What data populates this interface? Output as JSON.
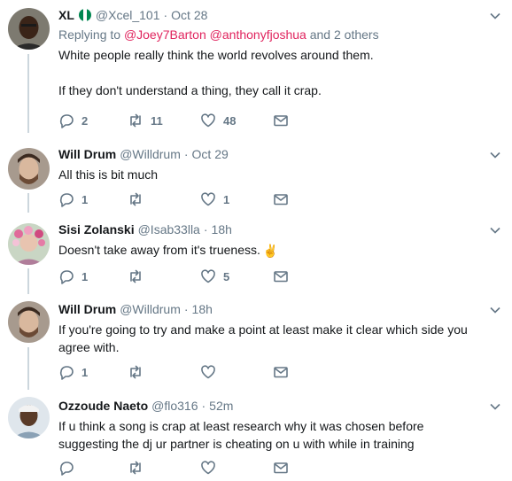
{
  "tweets": [
    {
      "name": "XL",
      "handle": "@Xcel_101",
      "sep": "·",
      "time": "Oct 28",
      "has_flag": true,
      "reply_prefix": "Replying to",
      "reply_mentions": [
        "@Joey7Barton",
        "@anthonyfjoshua"
      ],
      "reply_others": "and 2 others",
      "paragraphs": [
        "White people really think the world revolves around them.",
        "If they don't understand a thing, they call it crap."
      ],
      "counts": {
        "replies": "2",
        "retweets": "11",
        "likes": "48"
      }
    },
    {
      "name": "Will Drum",
      "handle": "@Willdrum",
      "sep": "·",
      "time": "Oct 29",
      "paragraphs": [
        "All this is bit much"
      ],
      "counts": {
        "replies": "1",
        "retweets": "",
        "likes": "1"
      }
    },
    {
      "name": "Sisi Zolanski",
      "handle": "@Isab33lla",
      "sep": "·",
      "time": "18h",
      "paragraphs": [
        "Doesn't take away from it's trueness."
      ],
      "emoji": "✌️",
      "counts": {
        "replies": "1",
        "retweets": "",
        "likes": "5"
      }
    },
    {
      "name": "Will Drum",
      "handle": "@Willdrum",
      "sep": "·",
      "time": "18h",
      "paragraphs": [
        "If you're going to try and make a point at least make it clear which side you agree with."
      ],
      "counts": {
        "replies": "1",
        "retweets": "",
        "likes": ""
      }
    },
    {
      "name": "Ozzoude Naeto",
      "handle": "@flo316",
      "sep": "·",
      "time": "52m",
      "paragraphs": [
        "If u think a song is crap at least research why it was chosen before suggesting the dj ur partner is cheating on u with while in training"
      ],
      "counts": {
        "replies": "",
        "retweets": "",
        "likes": ""
      }
    }
  ],
  "colors": {
    "mention": "#e0245e",
    "muted": "#657786",
    "thread_line": "#ccd6dd",
    "divider": "#e6ecf0"
  },
  "icons": [
    "reply-icon",
    "retweet-icon",
    "like-icon",
    "direct-message-icon",
    "caret-down-icon"
  ]
}
